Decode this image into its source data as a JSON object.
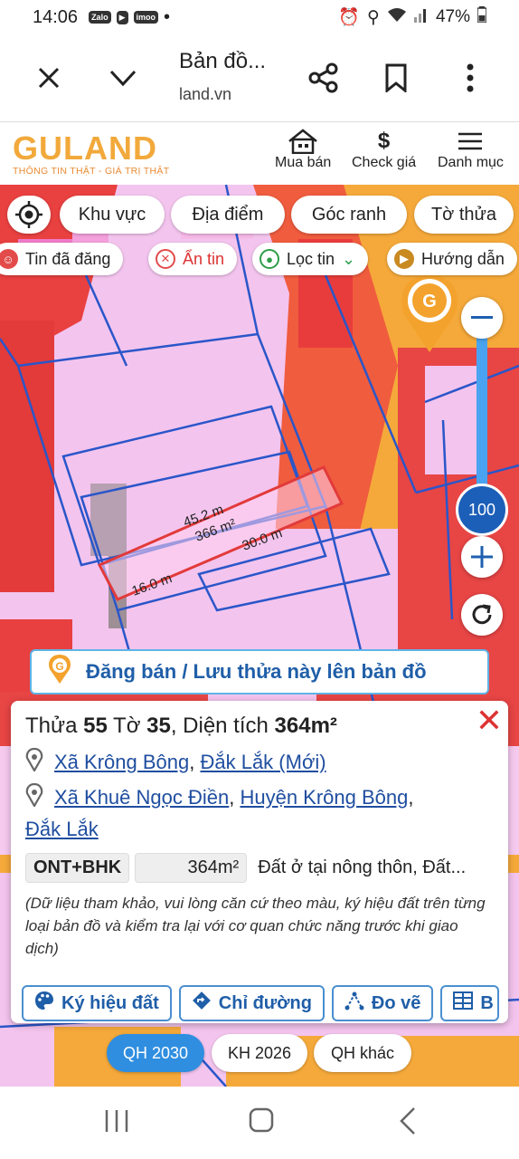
{
  "status": {
    "time": "14:06",
    "badges": [
      "Zalo",
      "",
      "imoo"
    ],
    "battery": "47%"
  },
  "browser": {
    "title": "Bản đồ...",
    "url": "land.vn"
  },
  "site": {
    "logo": "GULAND",
    "slogan": "THÔNG TIN THẬT - GIÁ TRỊ THẬT",
    "nav": [
      {
        "label": "Mua bán",
        "icon": "house-icon"
      },
      {
        "label": "Check giá",
        "icon": "dollar-icon"
      },
      {
        "label": "Danh mục",
        "icon": "menu-icon"
      }
    ]
  },
  "toolbar": {
    "chips": [
      "Khu vực",
      "Địa điểm",
      "Góc ranh",
      "Tờ thửa"
    ]
  },
  "filters": [
    {
      "label": "Tin đã đăng"
    },
    {
      "label": "Ẩn tin"
    },
    {
      "label": "Lọc tin"
    },
    {
      "label": "Hướng dẫn"
    }
  ],
  "map": {
    "zoom": "100",
    "parcel": {
      "top_edge": "45.2 m",
      "area": "366 m²",
      "right_edge": "30.0 m",
      "left_edge": "16.0 m"
    }
  },
  "post_bar": {
    "label": "Đăng bán / Lưu thửa này lên bản đồ"
  },
  "card": {
    "title_parts": {
      "p1": "Thửa ",
      "parcel": "55",
      "p2": " Tờ ",
      "sheet": "35",
      "p3": ", Diện tích ",
      "area": "364m²"
    },
    "address1": {
      "commune": "Xã Krông Bông",
      "sep": ", ",
      "province": "Đắk Lắk (Mới)"
    },
    "address2": {
      "commune": "Xã Khuê Ngọc Điền",
      "sep": ", ",
      "district": "Huyện Krông Bông",
      "sep2": ",",
      "province": "Đắk Lắk"
    },
    "land_code": "ONT+BHK",
    "land_area": "364m²",
    "land_desc": "Đất ở tại nông thôn, Đất...",
    "note": "(Dữ liệu tham khảo, vui lòng căn cứ theo màu, ký hiệu đất trên từng loại bản đồ và kiểm tra lại với cơ quan chức năng trước khi giao dịch)",
    "actions": [
      "Ký hiệu đất",
      "Chỉ đường",
      "Đo vẽ",
      "B"
    ]
  },
  "layers": [
    {
      "label": "QH 2030",
      "active": true
    },
    {
      "label": "KH 2026",
      "active": false
    },
    {
      "label": "QH khác",
      "active": false
    }
  ],
  "colors": {
    "accent": "#2f8ee0",
    "brand": "#f2a93b",
    "link": "#1f4ea0",
    "close": "#d33333"
  }
}
